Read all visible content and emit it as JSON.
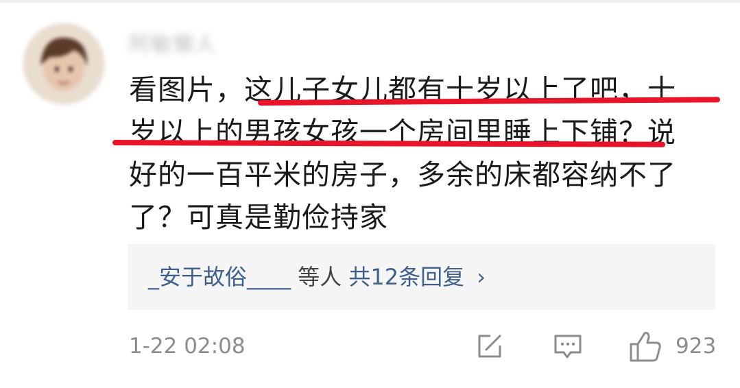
{
  "comment": {
    "username": "阿敏懒人",
    "text_lines": [
      "看图片，这儿子女儿都有十岁以上了吧，十",
      "岁以上的男孩女孩一个房间里睡上下铺？说",
      "好的一百平米的房子，多余的床都容纳不了",
      "了？可真是勤俭持家"
    ],
    "annotation_color": "#e8142a"
  },
  "reply_summary": {
    "replier": "_安于故俗____",
    "others": "等人",
    "total": "共12条回复",
    "chevron": "›"
  },
  "footer": {
    "timestamp": "1-22 02:08",
    "share_icon": "share-edit-icon",
    "comment_icon": "comment-bubble-icon",
    "like_icon": "thumbs-up-icon",
    "like_count": "923"
  },
  "colors": {
    "link": "#3e5f8c",
    "muted": "#8c8c8c",
    "text": "#1a1a1a",
    "reply_bg": "#f5f5f5"
  }
}
